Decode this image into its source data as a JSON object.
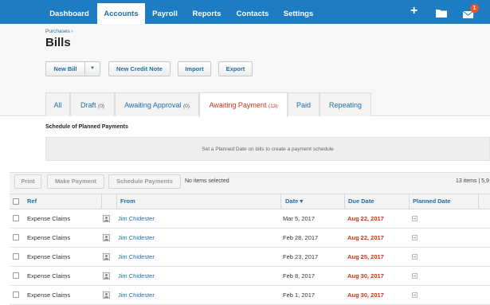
{
  "nav": {
    "items": [
      "Dashboard",
      "Accounts",
      "Payroll",
      "Reports",
      "Contacts",
      "Settings"
    ],
    "active": "Accounts",
    "icons": [
      "add-icon",
      "folder-icon",
      "mail-icon"
    ],
    "mail_badge": "1",
    "color": "#1d7cc2"
  },
  "header": {
    "breadcrumb": "Purchases ›",
    "title": "Bills"
  },
  "actions": {
    "new_bill": "New Bill",
    "new_credit_note": "New Credit Note",
    "import": "Import",
    "export": "Export"
  },
  "tabs": [
    {
      "label": "All",
      "count": ""
    },
    {
      "label": "Draft",
      "count": "(0)"
    },
    {
      "label": "Awaiting Approval",
      "count": "(0)"
    },
    {
      "label": "Awaiting Payment",
      "count": "(13)"
    },
    {
      "label": "Paid",
      "count": ""
    },
    {
      "label": "Repeating",
      "count": ""
    }
  ],
  "active_tab": "Awaiting Payment",
  "schedule": {
    "title": "Schedule of Planned Payments",
    "message": "Set a Planned Date on bills to create a payment schedule"
  },
  "toolbar": {
    "print": "Print",
    "make_payment": "Make Payment",
    "schedule_payments": "Schedule Payments",
    "selection": "No items selected",
    "items_info": "13 items | 5,9"
  },
  "table": {
    "columns": [
      "Ref",
      "From",
      "Date ▾",
      "Due Date",
      "Planned Date"
    ],
    "rows": [
      {
        "ref": "Expense Claims",
        "from": "Jim Chidester",
        "date": "Mar 5, 2017",
        "due": "Aug 22, 2017"
      },
      {
        "ref": "Expense Claims",
        "from": "Jim Chidester",
        "date": "Feb 28, 2017",
        "due": "Aug 22, 2017"
      },
      {
        "ref": "Expense Claims",
        "from": "Jim Chidester",
        "date": "Feb 23, 2017",
        "due": "Aug 25, 2017"
      },
      {
        "ref": "Expense Claims",
        "from": "Jim Chidester",
        "date": "Feb 8, 2017",
        "due": "Aug 30, 2017"
      },
      {
        "ref": "Expense Claims",
        "from": "Jim Chidester",
        "date": "Feb 1, 2017",
        "due": "Aug 30, 2017"
      }
    ]
  },
  "colors": {
    "accent": "#1d6fa8",
    "overdue": "#c8351a"
  }
}
